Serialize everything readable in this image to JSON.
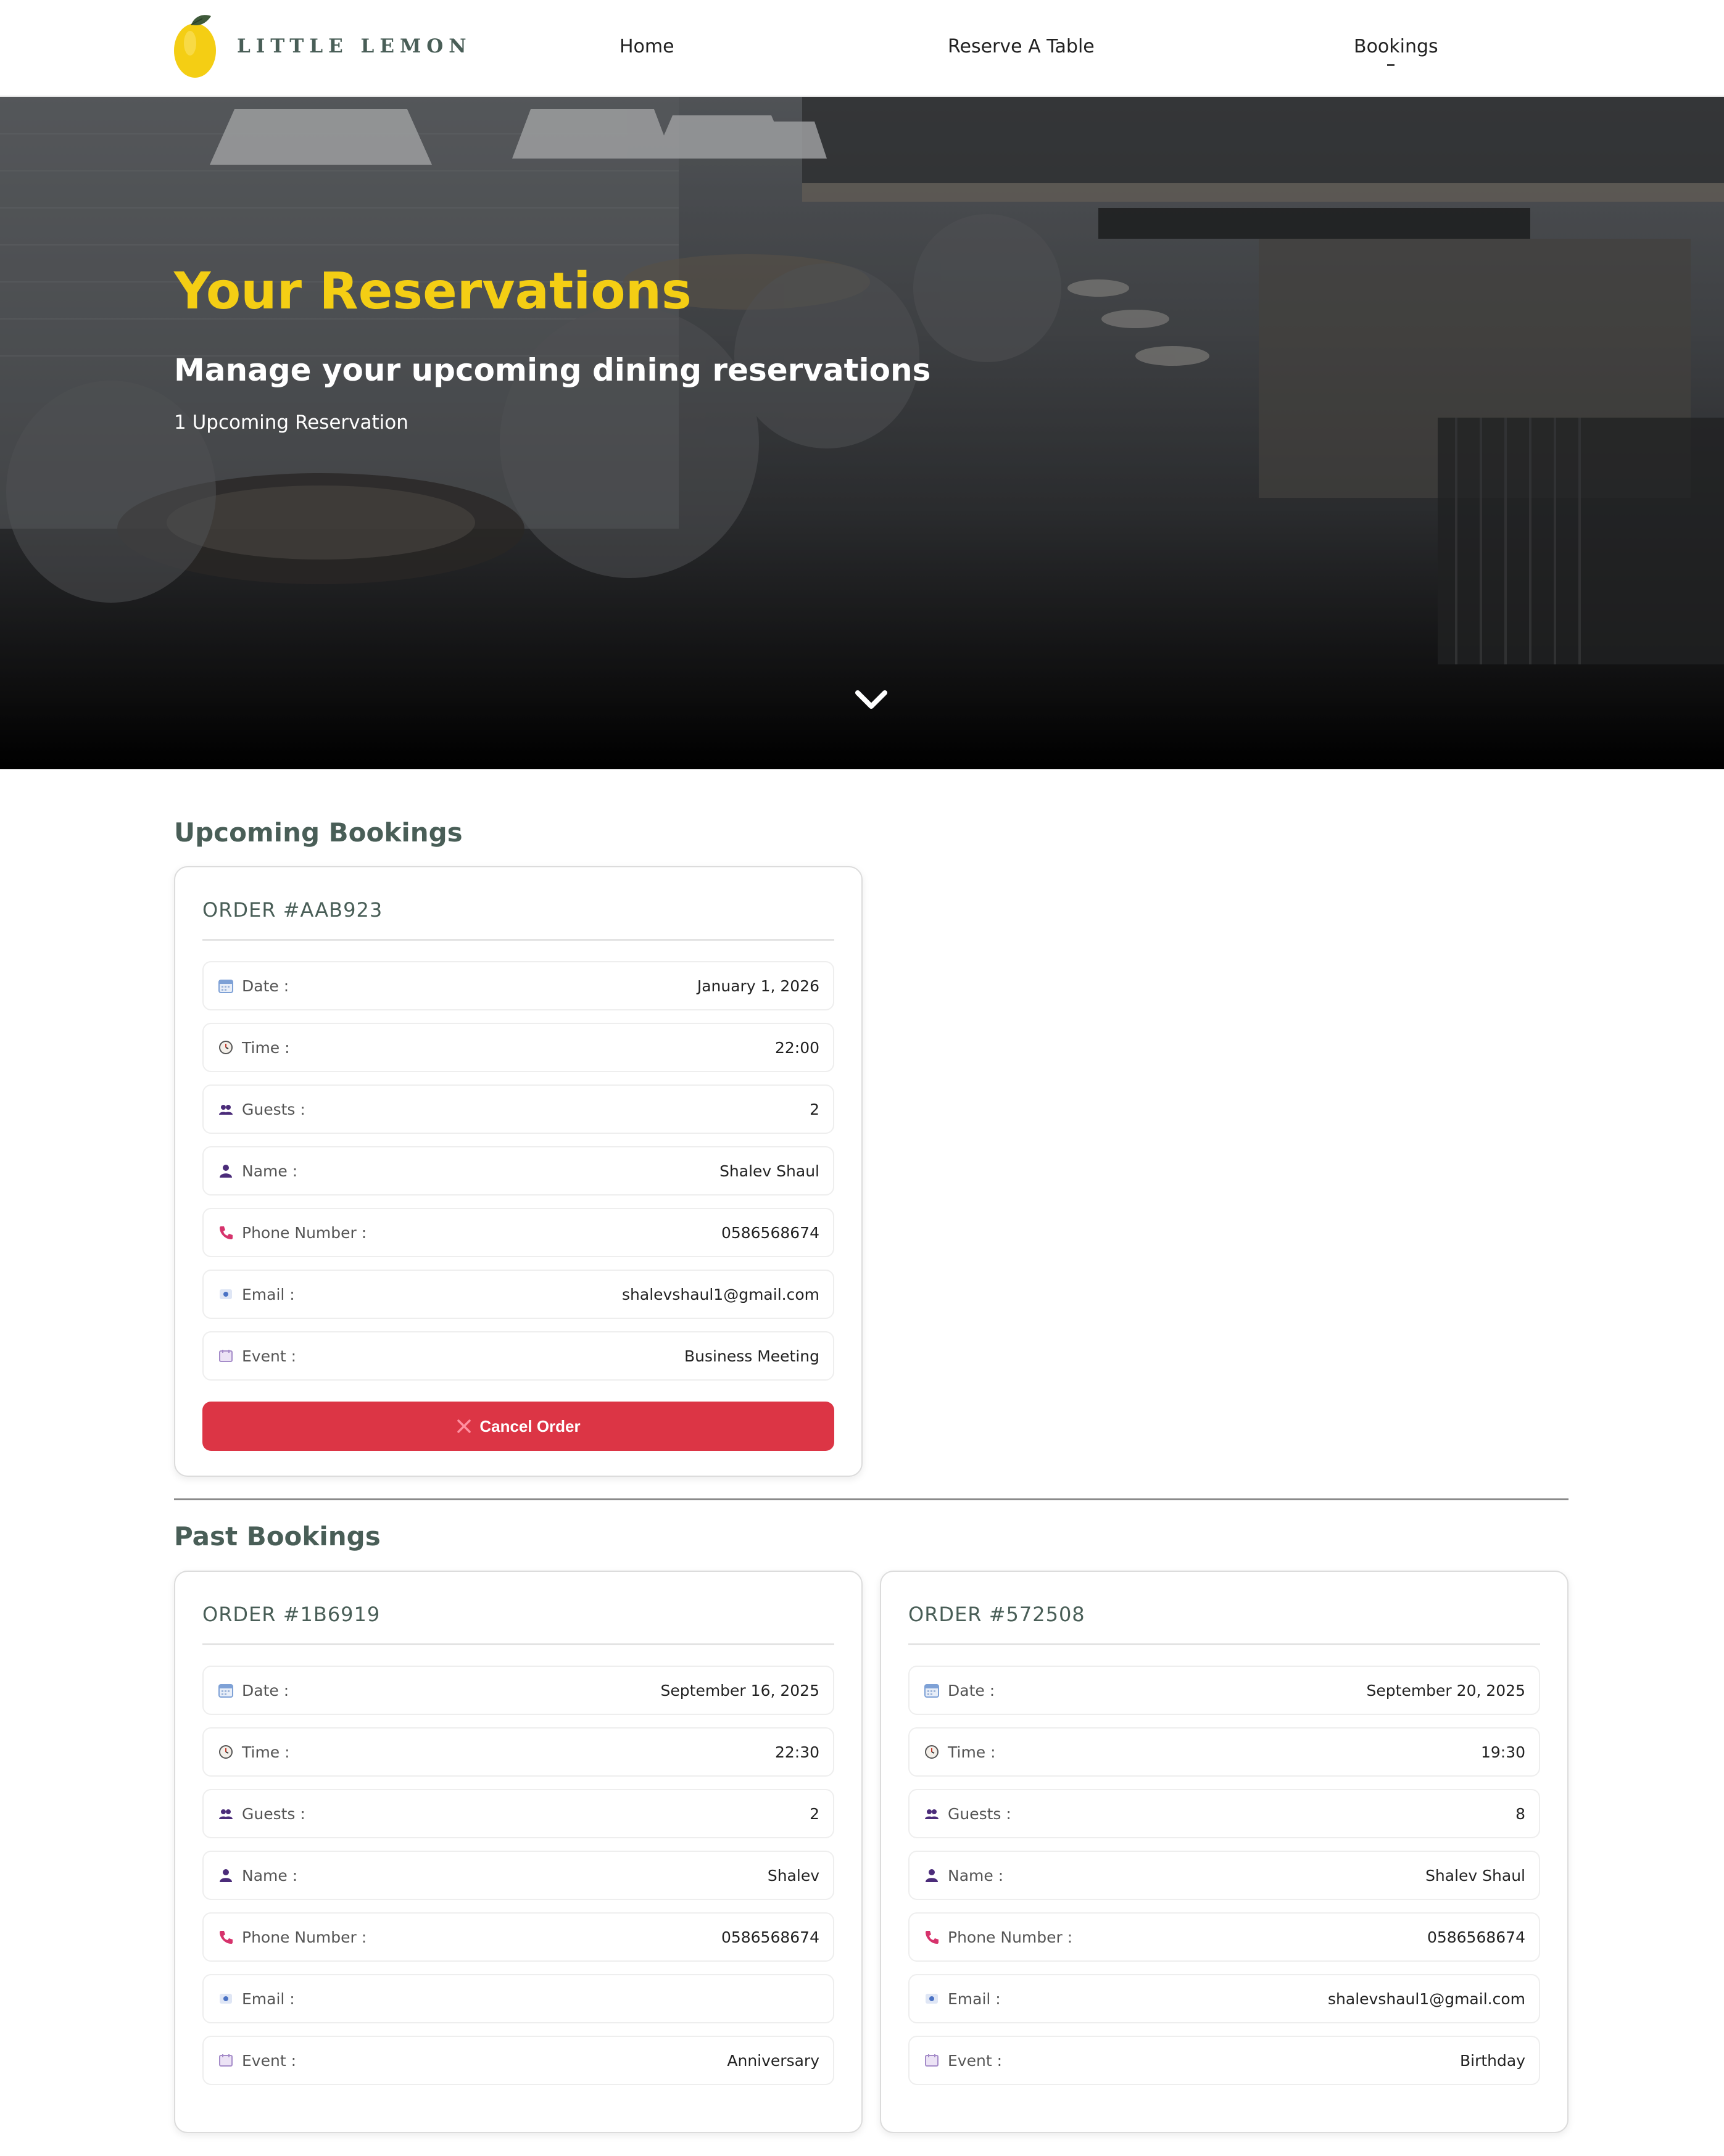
{
  "brand": {
    "name": "LITTLE LEMON",
    "logo_icon": "lemon-icon"
  },
  "nav": {
    "items": [
      {
        "label": "Home"
      },
      {
        "label": "Reserve A Table"
      },
      {
        "label": "Bookings"
      }
    ]
  },
  "hero": {
    "title": "Your Reservations",
    "subtitle": "Manage your upcoming dining reservations",
    "count_text": "1 Upcoming Reservation",
    "scroll_icon": "chevron-down-icon"
  },
  "labels": {
    "date": "Date :",
    "time": "Time :",
    "guests": "Guests :",
    "name": "Name :",
    "phone": "Phone Number :",
    "email": "Email :",
    "event": "Event :"
  },
  "upcoming": {
    "heading": "Upcoming Bookings",
    "orders": [
      {
        "order_id": "ORDER #AAB923",
        "date": "January 1, 2026",
        "time": "22:00",
        "guests": "2",
        "name": "Shalev Shaul",
        "phone": "0586568674",
        "email": "shalevshaul1@gmail.com",
        "event": "Business Meeting",
        "cancel_label": "Cancel Order"
      }
    ]
  },
  "past": {
    "heading": "Past Bookings",
    "orders": [
      {
        "order_id": "ORDER #1B6919",
        "date": "September 16, 2025",
        "time": "22:30",
        "guests": "2",
        "name": "Shalev",
        "phone": "0586568674",
        "email": "",
        "event": "Anniversary"
      },
      {
        "order_id": "ORDER #572508",
        "date": "September 20, 2025",
        "time": "19:30",
        "guests": "8",
        "name": "Shalev Shaul",
        "phone": "0586568674",
        "email": "shalevshaul1@gmail.com",
        "event": "Birthday"
      }
    ]
  },
  "colors": {
    "brand_green": "#495e57",
    "brand_yellow": "#f4ce14",
    "danger": "#dc3545"
  }
}
